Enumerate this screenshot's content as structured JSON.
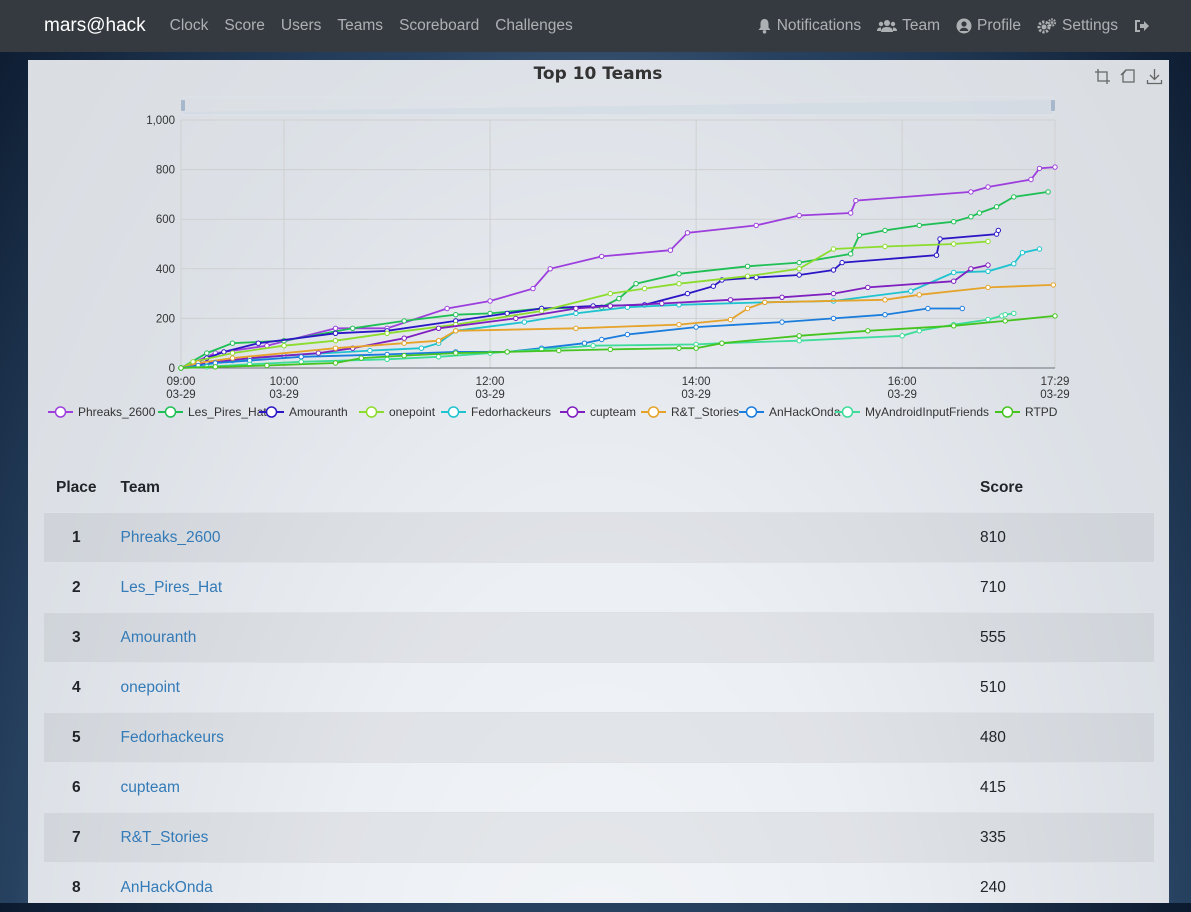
{
  "navbar": {
    "brand": "mars@hack",
    "links": [
      "Clock",
      "Score",
      "Users",
      "Teams",
      "Scoreboard",
      "Challenges"
    ],
    "right": {
      "notifications": "Notifications",
      "team": "Team",
      "profile": "Profile",
      "settings": "Settings"
    }
  },
  "chart_data": {
    "type": "line",
    "title": "Top 10 Teams",
    "xlabel": "",
    "ylabel": "",
    "x_ticks": [
      "09:00\n03-29",
      "10:00\n03-29",
      "12:00\n03-29",
      "14:00\n03-29",
      "16:00\n03-29",
      "17:29\n03-29"
    ],
    "xlim": [
      "09:00",
      "17:29"
    ],
    "ylim": [
      0,
      1000
    ],
    "y_ticks": [
      0,
      200,
      400,
      600,
      800,
      "1,000"
    ],
    "grid": true,
    "legend_position": "bottom",
    "series": [
      {
        "name": "Phreaks_2600",
        "color": "#9d3fdd",
        "x": [
          "09:00",
          "09:20",
          "09:50",
          "10:30",
          "11:00",
          "11:35",
          "12:00",
          "12:25",
          "12:35",
          "13:05",
          "13:45",
          "13:55",
          "14:35",
          "15:00",
          "15:30",
          "15:33",
          "16:40",
          "16:50",
          "17:15",
          "17:20",
          "17:29"
        ],
        "y": [
          0,
          60,
          90,
          160,
          160,
          240,
          270,
          320,
          400,
          450,
          475,
          545,
          575,
          615,
          625,
          675,
          710,
          730,
          760,
          805,
          810
        ]
      },
      {
        "name": "Les_Pires_Hat",
        "color": "#1fbf55",
        "x": [
          "09:00",
          "09:15",
          "09:30",
          "10:00",
          "10:40",
          "11:10",
          "11:40",
          "12:00",
          "12:30",
          "13:05",
          "13:15",
          "13:25",
          "13:50",
          "14:30",
          "15:00",
          "15:30",
          "15:35",
          "15:50",
          "16:10",
          "16:30",
          "16:40",
          "16:45",
          "16:55",
          "17:05",
          "17:25"
        ],
        "y": [
          0,
          60,
          100,
          110,
          160,
          190,
          215,
          220,
          240,
          245,
          280,
          340,
          380,
          410,
          425,
          460,
          535,
          555,
          575,
          590,
          610,
          625,
          650,
          690,
          710
        ]
      },
      {
        "name": "Amouranth",
        "color": "#2b16c6",
        "x": [
          "09:00",
          "09:15",
          "09:25",
          "09:45",
          "10:30",
          "11:00",
          "11:40",
          "12:10",
          "12:30",
          "13:00",
          "13:30",
          "13:55",
          "14:10",
          "14:15",
          "14:35",
          "15:00",
          "15:20",
          "15:25",
          "16:20",
          "16:22",
          "16:55",
          "16:56"
        ],
        "y": [
          0,
          40,
          65,
          100,
          140,
          150,
          190,
          220,
          240,
          250,
          255,
          300,
          330,
          355,
          365,
          375,
          395,
          425,
          455,
          520,
          540,
          555
        ]
      },
      {
        "name": "onepoint",
        "color": "#8cdc2d",
        "x": [
          "09:00",
          "09:07",
          "09:30",
          "10:00",
          "10:30",
          "11:00",
          "11:40",
          "12:30",
          "13:10",
          "13:30",
          "13:50",
          "14:30",
          "15:00",
          "15:20",
          "15:50",
          "16:30",
          "16:50"
        ],
        "y": [
          0,
          25,
          60,
          90,
          110,
          140,
          175,
          230,
          300,
          320,
          340,
          370,
          400,
          480,
          490,
          500,
          510
        ]
      },
      {
        "name": "Fedorhackeurs",
        "color": "#1ec3cf",
        "x": [
          "09:00",
          "09:30",
          "10:00",
          "10:50",
          "11:20",
          "11:30",
          "11:40",
          "12:20",
          "12:50",
          "13:20",
          "13:50",
          "14:40",
          "15:20",
          "16:05",
          "16:30",
          "16:50",
          "17:05",
          "17:10",
          "17:20"
        ],
        "y": [
          0,
          30,
          50,
          70,
          80,
          100,
          150,
          185,
          220,
          245,
          255,
          265,
          270,
          310,
          385,
          390,
          420,
          465,
          480
        ]
      },
      {
        "name": "cupteam",
        "color": "#7f1fc0",
        "x": [
          "09:00",
          "09:15",
          "09:40",
          "10:20",
          "10:40",
          "11:10",
          "11:30",
          "12:15",
          "12:50",
          "13:10",
          "13:40",
          "14:20",
          "14:50",
          "15:20",
          "15:40",
          "16:30",
          "16:40",
          "16:50"
        ],
        "y": [
          0,
          20,
          40,
          60,
          80,
          120,
          160,
          200,
          240,
          250,
          260,
          275,
          285,
          300,
          325,
          350,
          400,
          415
        ]
      },
      {
        "name": "R&T_Stories",
        "color": "#e5a32a",
        "x": [
          "09:00",
          "09:10",
          "09:30",
          "10:30",
          "11:10",
          "11:30",
          "11:40",
          "12:50",
          "13:50",
          "14:20",
          "14:30",
          "14:40",
          "15:50",
          "16:10",
          "16:50",
          "17:28"
        ],
        "y": [
          0,
          20,
          40,
          80,
          100,
          110,
          150,
          160,
          175,
          195,
          240,
          265,
          275,
          295,
          325,
          335
        ]
      },
      {
        "name": "AnHackOnda",
        "color": "#1a7cdc",
        "x": [
          "09:00",
          "09:10",
          "09:20",
          "09:40",
          "10:10",
          "11:00",
          "11:40",
          "12:10",
          "12:30",
          "12:55",
          "13:05",
          "13:20",
          "14:00",
          "14:50",
          "15:20",
          "15:50",
          "16:15",
          "16:35"
        ],
        "y": [
          0,
          10,
          20,
          30,
          45,
          55,
          65,
          65,
          80,
          100,
          115,
          135,
          165,
          185,
          200,
          215,
          240,
          240
        ]
      },
      {
        "name": "MyAndroidInputFriends",
        "color": "#3ddc9a",
        "x": [
          "09:00",
          "09:15",
          "09:40",
          "10:10",
          "11:00",
          "11:30",
          "12:00",
          "12:30",
          "13:00",
          "14:00",
          "14:15",
          "15:00",
          "16:00",
          "16:10",
          "16:30",
          "16:50",
          "16:58",
          "17:00",
          "17:05"
        ],
        "y": [
          0,
          5,
          15,
          25,
          35,
          45,
          60,
          75,
          90,
          95,
          100,
          110,
          130,
          150,
          175,
          195,
          210,
          215,
          220
        ]
      },
      {
        "name": "RTPD",
        "color": "#45c41f",
        "x": [
          "09:00",
          "09:20",
          "09:50",
          "10:30",
          "10:45",
          "11:10",
          "11:40",
          "12:10",
          "12:40",
          "13:10",
          "13:50",
          "14:00",
          "14:15",
          "15:00",
          "15:40",
          "16:30",
          "17:00",
          "17:29"
        ],
        "y": [
          0,
          5,
          10,
          20,
          40,
          50,
          60,
          65,
          70,
          75,
          80,
          80,
          100,
          130,
          150,
          170,
          190,
          210
        ]
      }
    ]
  },
  "scoreboard": {
    "headers": {
      "place": "Place",
      "team": "Team",
      "score": "Score"
    },
    "rows": [
      {
        "place": "1",
        "team": "Phreaks_2600",
        "score": "810"
      },
      {
        "place": "2",
        "team": "Les_Pires_Hat",
        "score": "710"
      },
      {
        "place": "3",
        "team": "Amouranth",
        "score": "555"
      },
      {
        "place": "4",
        "team": "onepoint",
        "score": "510"
      },
      {
        "place": "5",
        "team": "Fedorhackeurs",
        "score": "480"
      },
      {
        "place": "6",
        "team": "cupteam",
        "score": "415"
      },
      {
        "place": "7",
        "team": "R&T_Stories",
        "score": "335"
      },
      {
        "place": "8",
        "team": "AnHackOnda",
        "score": "240"
      }
    ]
  }
}
